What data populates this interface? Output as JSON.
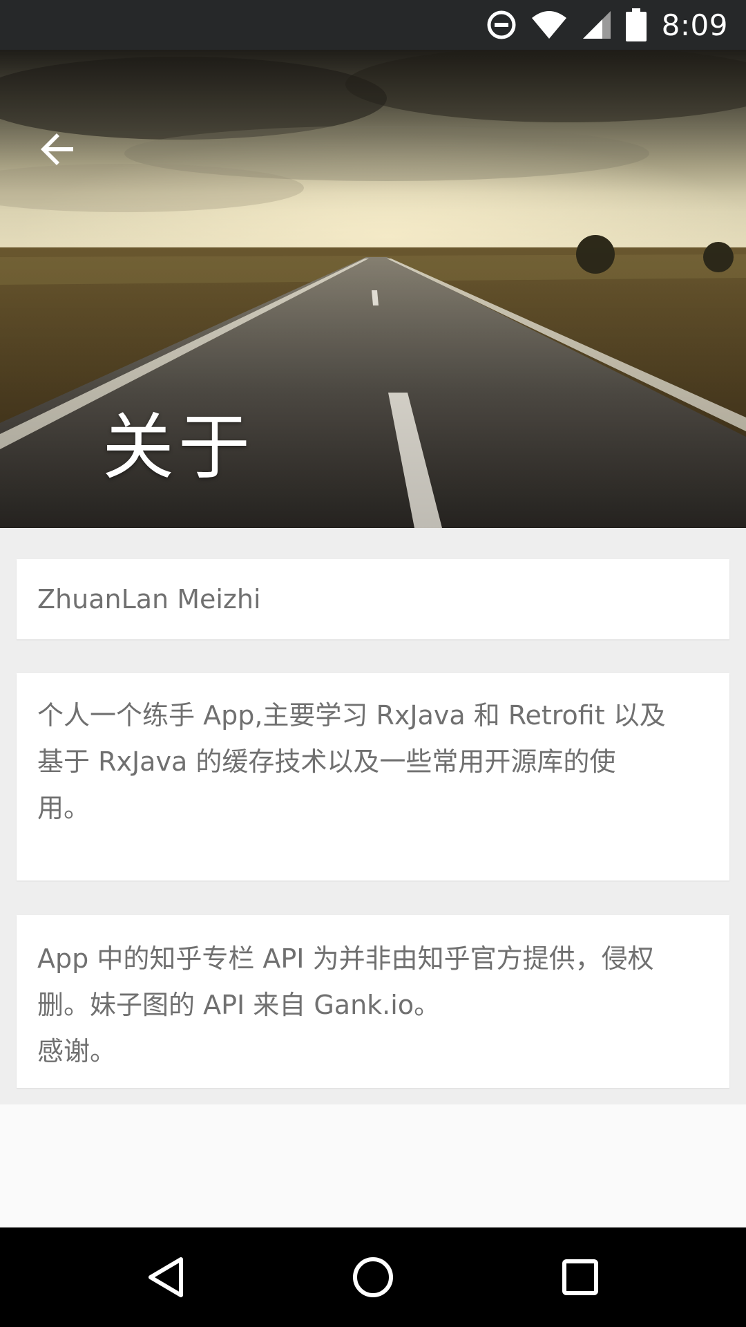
{
  "status_bar": {
    "time": "8:09",
    "icons": [
      "do-not-disturb-icon",
      "wifi-icon",
      "cell-signal-icon",
      "battery-icon"
    ]
  },
  "header": {
    "title": "关于",
    "back_icon": "arrow-back-icon"
  },
  "cards": {
    "app_name": "ZhuanLan Meizhi",
    "description": "个人一个练手 App,主要学习 RxJava 和 Retrofit 以及\n基于 RxJava 的缓存技术以及一些常用开源库的使\n用。",
    "notice": "App 中的知乎专栏 API 为并非由知乎官方提供，侵权\n删。妹子图的 API 来自 Gank.io。\n感谢。"
  },
  "nav_bar": {
    "buttons": [
      "back-triangle-icon",
      "home-circle-icon",
      "recents-square-icon"
    ]
  },
  "colors": {
    "status_bar": "#262829",
    "content_bg": "#eeeeee",
    "card_bg": "#ffffff",
    "card_text": "#707070",
    "nav_bar": "#000000"
  }
}
